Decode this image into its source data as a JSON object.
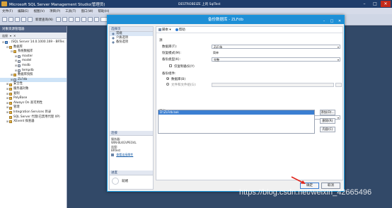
{
  "window": {
    "title": "Microsoft SQL Server Management Studio(管理员)",
    "center_title": "DESTROBEIZE 上的 SqlTest"
  },
  "menubar": [
    "文件(F)",
    "编辑(E)",
    "视图(V)",
    "项目(P)",
    "工具(T)",
    "窗口(W)",
    "帮助(H)"
  ],
  "toolbar": {
    "new_query": "新建查询(N)"
  },
  "object_explorer": {
    "title": "对象资源管理器",
    "toolbar": [
      "连接",
      "▾",
      "✕"
    ],
    "tree": [
      {
        "label": ". (SQL Server 14.0.1000.169 - BRTes",
        "indent": 0,
        "expander": "⊟",
        "icon": "server"
      },
      {
        "label": "数据库",
        "indent": 1,
        "expander": "⊟",
        "icon": "folder"
      },
      {
        "label": "系统数据库",
        "indent": 2,
        "expander": "⊟",
        "icon": "folder"
      },
      {
        "label": "master",
        "indent": 3,
        "expander": "⊞",
        "icon": "db"
      },
      {
        "label": "model",
        "indent": 3,
        "expander": "⊞",
        "icon": "db"
      },
      {
        "label": "msdb",
        "indent": 3,
        "expander": "⊞",
        "icon": "db"
      },
      {
        "label": "tempdb",
        "indent": 3,
        "expander": "⊞",
        "icon": "db"
      },
      {
        "label": "数据库快照",
        "indent": 2,
        "expander": "⊞",
        "icon": "folder"
      },
      {
        "label": "ZLFdb",
        "indent": 2,
        "expander": "⊞",
        "icon": "db",
        "selected": true
      },
      {
        "label": "安全性",
        "indent": 1,
        "expander": "⊞",
        "icon": "folder"
      },
      {
        "label": "服务器对象",
        "indent": 1,
        "expander": "⊞",
        "icon": "folder"
      },
      {
        "label": "复制",
        "indent": 1,
        "expander": "⊞",
        "icon": "folder"
      },
      {
        "label": "PolyBase",
        "indent": 1,
        "expander": "⊞",
        "icon": "folder"
      },
      {
        "label": "Always On 高可用性",
        "indent": 1,
        "expander": "⊞",
        "icon": "folder"
      },
      {
        "label": "管理",
        "indent": 1,
        "expander": "⊞",
        "icon": "folder"
      },
      {
        "label": "Integration Services 目录",
        "indent": 1,
        "expander": "⊞",
        "icon": "folder"
      },
      {
        "label": "SQL Server 代理(已禁用代理 XP)",
        "indent": 1,
        "expander": "",
        "icon": "folder"
      },
      {
        "label": "XEvent 探查器",
        "indent": 1,
        "expander": "⊞",
        "icon": "folder"
      }
    ]
  },
  "dialog": {
    "title": "备份数据库 - ZLFdb",
    "select_page_header": "选择页",
    "pages": [
      "常规",
      "介质选项",
      "备份选项"
    ],
    "connection_header": "连接",
    "connection": {
      "server_label": "服务器:",
      "server_value": "WIN-BLKGVPEO4L",
      "conn_label": "连接:",
      "conn_value": "BRTest",
      "link": "查看连接属性"
    },
    "progress_header": "进度",
    "progress_status": "就绪",
    "toolbar": {
      "script": "脚本",
      "help": "帮助"
    },
    "source_section": "源",
    "database_label": "数据库(T):",
    "database_value": "ZLFdb",
    "recovery_label": "恢复模式(M):",
    "recovery_value": "简单",
    "backup_type_label": "备份类型(K):",
    "backup_type_value": "完整",
    "copy_only_label": "仅复制备份(Y)",
    "component_label": "备份组件:",
    "component_db": "数据库(B)",
    "component_files": "文件和文件组(G):",
    "dest_section": "目标",
    "backup_to_label": "备份到(U):",
    "backup_to_value": "磁盘",
    "dest_items": [
      "D:\\ZLFdb.bak"
    ],
    "add_button": "添加(D)...",
    "remove_button": "删除(R)",
    "contents_button": "内容(C)",
    "ok_button": "确定",
    "cancel_button": "取消"
  },
  "watermark": "https://blog.csdn.net/weixin_42665496"
}
